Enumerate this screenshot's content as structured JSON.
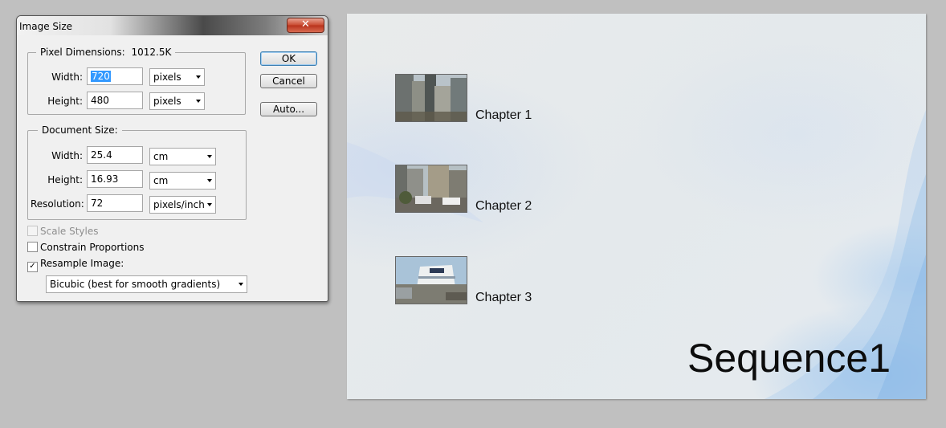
{
  "dialog": {
    "title": "Image Size",
    "close_label": "✕",
    "pixel_dimensions": {
      "label": "Pixel Dimensions:",
      "size": "1012.5K",
      "width_label": "Width:",
      "width_value": "720",
      "width_unit": "pixels",
      "height_label": "Height:",
      "height_value": "480",
      "height_unit": "pixels"
    },
    "document_size": {
      "label": "Document Size:",
      "width_label": "Width:",
      "width_value": "25.4",
      "width_unit": "cm",
      "height_label": "Height:",
      "height_value": "16.93",
      "height_unit": "cm",
      "resolution_label": "Resolution:",
      "resolution_value": "72",
      "resolution_unit": "pixels/inch"
    },
    "options": {
      "scale_styles": {
        "label": "Scale Styles",
        "checked": false,
        "enabled": false
      },
      "constrain_proportions": {
        "label": "Constrain Proportions",
        "checked": false
      },
      "resample_image": {
        "label": "Resample Image:",
        "checked": true
      },
      "resample_method": "Bicubic (best for smooth gradients)"
    },
    "buttons": {
      "ok": "OK",
      "cancel": "Cancel",
      "auto": "Auto..."
    }
  },
  "canvas": {
    "chapters": [
      {
        "label": "Chapter 1",
        "thumbnail": "city-buildings-thumbnail"
      },
      {
        "label": "Chapter 2",
        "thumbnail": "street-traffic-thumbnail"
      },
      {
        "label": "Chapter 3",
        "thumbnail": "cruise-ship-thumbnail"
      }
    ],
    "title": "Sequence1"
  }
}
